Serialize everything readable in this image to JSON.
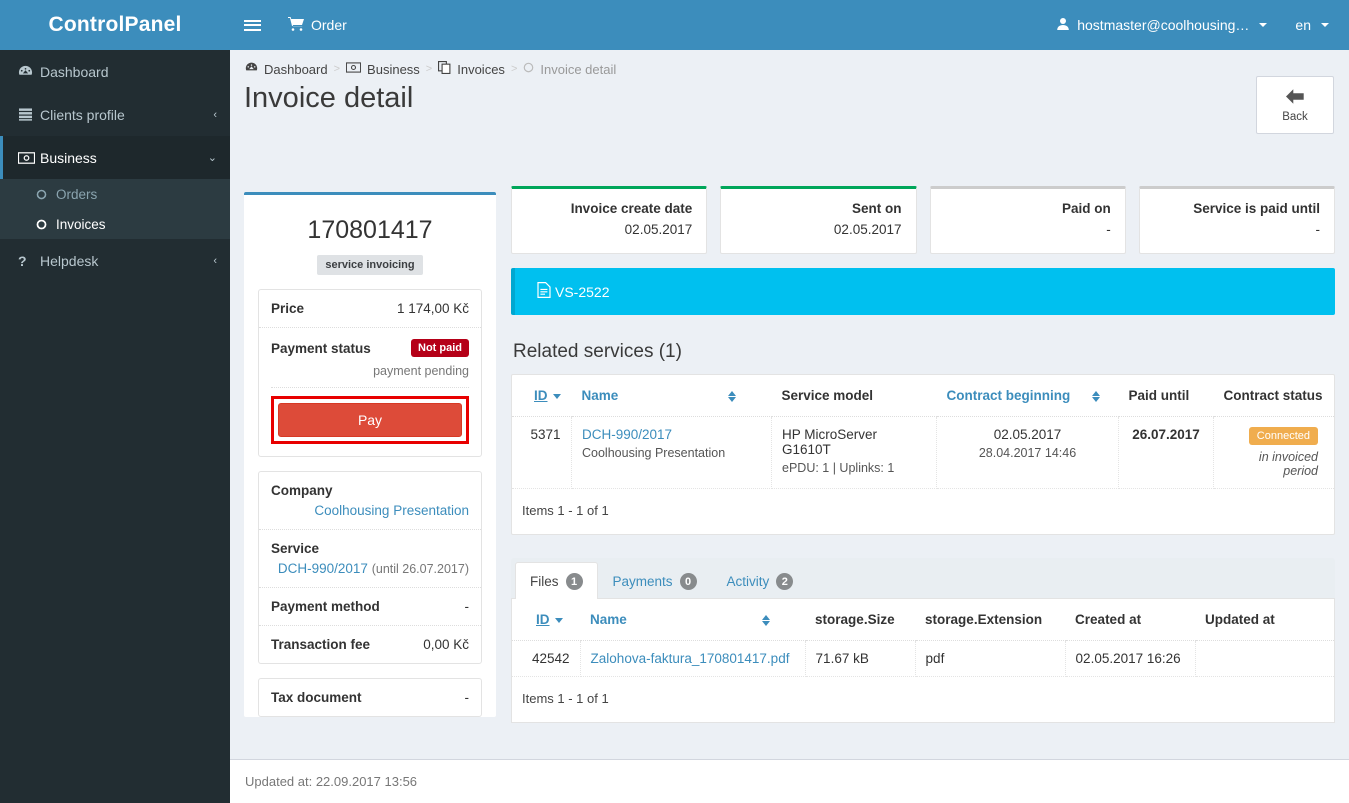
{
  "sidebar": {
    "logo": "ControlPanel",
    "items": [
      {
        "label": "Dashboard",
        "icon": "dashboard-icon",
        "caret": ""
      },
      {
        "label": "Clients profile",
        "icon": "clients-profile-icon",
        "caret": "‹"
      },
      {
        "label": "Business",
        "icon": "business-money-icon",
        "caret": "⌄"
      }
    ],
    "business_children": [
      {
        "label": "Orders",
        "icon": "circle-icon"
      },
      {
        "label": "Invoices",
        "icon": "circle-icon"
      }
    ],
    "helpdesk": {
      "label": "Helpdesk",
      "icon": "question-mark-icon",
      "caret": "‹"
    }
  },
  "navbar": {
    "order_label": "Order",
    "user_label": "hostmaster@coolhousing…",
    "lang_label": "en"
  },
  "breadcrumb": [
    {
      "label": "Dashboard",
      "icon": "dashboard-icon"
    },
    {
      "label": "Business",
      "icon": "business-money-icon"
    },
    {
      "label": "Invoices",
      "icon": "invoices-copy-icon"
    },
    {
      "label": "Invoice detail",
      "icon": "circle-icon"
    }
  ],
  "page": {
    "title": "Invoice detail",
    "back_label": "Back",
    "footer_text": "Updated at: 22.09.2017 13:56"
  },
  "invoice": {
    "number": "170801417",
    "type_badge": "service invoicing",
    "price_label": "Price",
    "price_value": "1 174,00 Kč",
    "payment_status_label": "Payment status",
    "payment_status_badge": "Not paid",
    "payment_status_note": "payment pending",
    "pay_button": "Pay",
    "company_label": "Company",
    "company_value": "Coolhousing Presentation",
    "service_label": "Service",
    "service_value": "DCH-990/2017",
    "service_until": "(until 26.07.2017)",
    "payment_method_label": "Payment method",
    "payment_method_value": "-",
    "transaction_fee_label": "Transaction fee",
    "transaction_fee_value": "0,00 Kč",
    "tax_document_label": "Tax document",
    "tax_document_value": "-"
  },
  "stats": [
    {
      "title": "Invoice create date",
      "value": "02.05.2017",
      "accent": "#00a65a"
    },
    {
      "title": "Sent on",
      "value": "02.05.2017",
      "accent": "#00a65a"
    },
    {
      "title": "Paid on",
      "value": "-",
      "accent": "#cccccc"
    },
    {
      "title": "Service is paid until",
      "value": "-",
      "accent": "#cccccc"
    }
  ],
  "vs_bar": {
    "label": "VS-2522",
    "icon": "file-text-icon",
    "color": "#00c0ef"
  },
  "related_services": {
    "title": "Related services (1)",
    "columns": [
      "ID",
      "Name",
      "Service model",
      "Contract beginning",
      "Paid until",
      "Contract status"
    ],
    "rows": [
      {
        "id": "5371",
        "name": "DCH-990/2017",
        "name_sub": "Coolhousing Presentation",
        "service_model": "HP MicroServer G1610T",
        "service_model_sub": "ePDU: 1 | Uplinks: 1",
        "contract_beginning": "02.05.2017",
        "contract_beginning_sub": "28.04.2017 14:46",
        "paid_until": "26.07.2017",
        "status_badge": "Connected",
        "status_note": "in invoiced period"
      }
    ],
    "items_count": "Items 1 - 1 of 1"
  },
  "tabs": [
    {
      "label": "Files",
      "count": "1",
      "active": true
    },
    {
      "label": "Payments",
      "count": "0",
      "active": false
    },
    {
      "label": "Activity",
      "count": "2",
      "active": false
    }
  ],
  "files_table": {
    "columns": [
      "ID",
      "Name",
      "storage.Size",
      "storage.Extension",
      "Created at",
      "Updated at"
    ],
    "rows": [
      {
        "id": "42542",
        "name": "Zalohova-faktura_170801417.pdf",
        "size": "71.67 kB",
        "extension": "pdf",
        "created_at": "02.05.2017 16:26",
        "updated_at": ""
      }
    ],
    "items_count": "Items 1 - 1 of 1"
  },
  "colors": {
    "brand_blue": "#3c8dbc",
    "sidebar_dark": "#222d32",
    "green": "#00a65a",
    "cyan": "#00c0ef",
    "danger_red": "#dd4b39",
    "badge_red": "#b50018",
    "orange": "#f0ad4e",
    "highlight_red_border": "#e80000"
  }
}
